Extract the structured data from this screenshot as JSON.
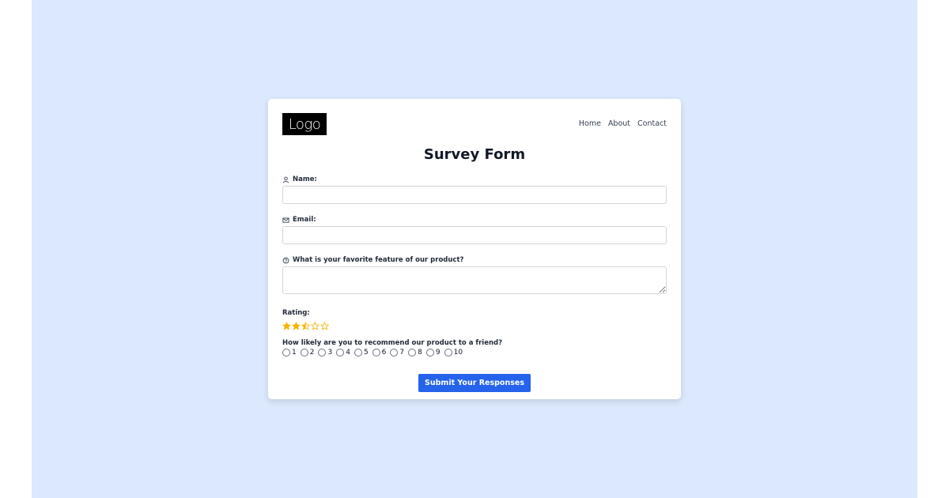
{
  "header": {
    "logo_text": "Logo",
    "nav": [
      {
        "label": "Home"
      },
      {
        "label": "About"
      },
      {
        "label": "Contact"
      }
    ]
  },
  "form": {
    "title": "Survey Form",
    "name": {
      "label": "Name:",
      "icon": "user-icon",
      "value": ""
    },
    "email": {
      "label": "Email:",
      "icon": "envelope-icon",
      "value": ""
    },
    "feature": {
      "label": "What is your favorite feature of our product?",
      "icon": "question-circle-icon",
      "value": ""
    },
    "rating": {
      "label": "Rating:",
      "value": 2.5,
      "max": 5,
      "star_color": "#f5b301"
    },
    "recommend": {
      "label": "How likely are you to recommend our product to a friend?",
      "options": [
        "1",
        "2",
        "3",
        "4",
        "5",
        "6",
        "7",
        "8",
        "9",
        "10"
      ],
      "selected": null
    },
    "submit_label": "Submit Your Responses"
  },
  "colors": {
    "backdrop": "#dbe8fd",
    "accent": "#2563eb",
    "star": "#f5b301"
  }
}
